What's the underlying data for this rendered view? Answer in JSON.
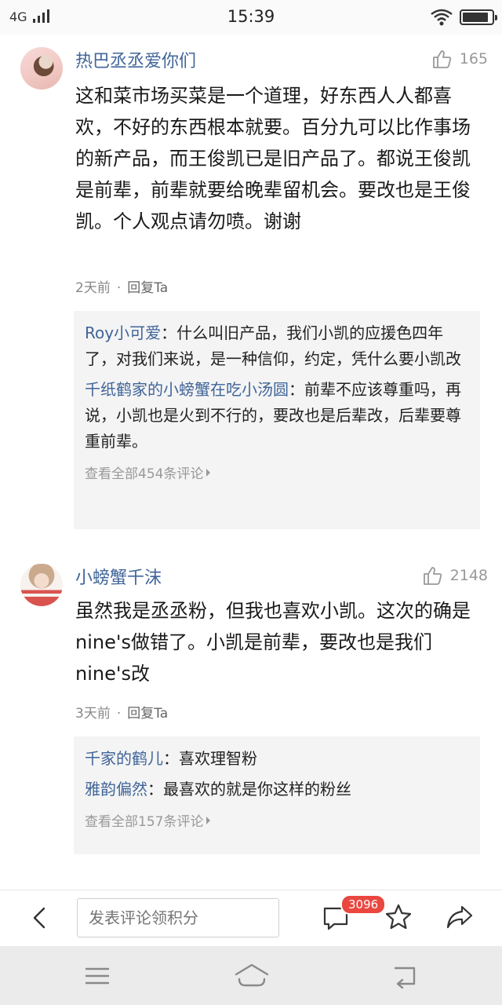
{
  "status_bar": {
    "network": "4G",
    "time": "15:39",
    "battery_level": 0.9
  },
  "comments": [
    {
      "username": "热巴丞丞爱你们",
      "likes": "165",
      "text": "这和菜市场买菜是一个道理，好东西人人都喜欢，不好的东西根本就要。百分九可以比作事场的新产品，而王俊凯已是旧产品了。都说王俊凯是前辈，前辈就要给晚辈留机会。要改也是王俊凯。个人观点请勿喷。谢谢",
      "time": "2天前",
      "separator": "·",
      "reply_label": "回复Ta",
      "replies": [
        {
          "name": "Roy小可爱",
          "sep": "：",
          "text": "什么叫旧产品，我们小凯的应援色四年了，对我们来说，是一种信仰，约定，凭什么要小凯改"
        },
        {
          "name": "千纸鹤家的小螃蟹在吃小汤圆",
          "sep": "：",
          "text": "前辈不应该尊重吗，再说，小凯也是火到不行的，要改也是后辈改，后辈要尊重前辈。"
        }
      ],
      "view_all": "查看全部454条评论"
    },
    {
      "username": "小螃蟹千沫",
      "likes": "2148",
      "text": "虽然我是丞丞粉，但我也喜欢小凯。这次的确是nine's做错了。小凯是前辈，要改也是我们nine's改",
      "time": "3天前",
      "separator": "·",
      "reply_label": "回复Ta",
      "replies": [
        {
          "name": "千家的鹤儿",
          "sep": "：",
          "text": "喜欢理智粉"
        },
        {
          "name": "雅韵偏然",
          "sep": "：",
          "text": "最喜欢的就是你这样的粉丝"
        }
      ],
      "view_all": "查看全部157条评论"
    }
  ],
  "action_bar": {
    "input_placeholder": "发表评论领积分",
    "comment_count": "3096"
  },
  "colors": {
    "username": "#406599",
    "badge": "#e9473f",
    "reply_bg": "#f4f4f4"
  }
}
